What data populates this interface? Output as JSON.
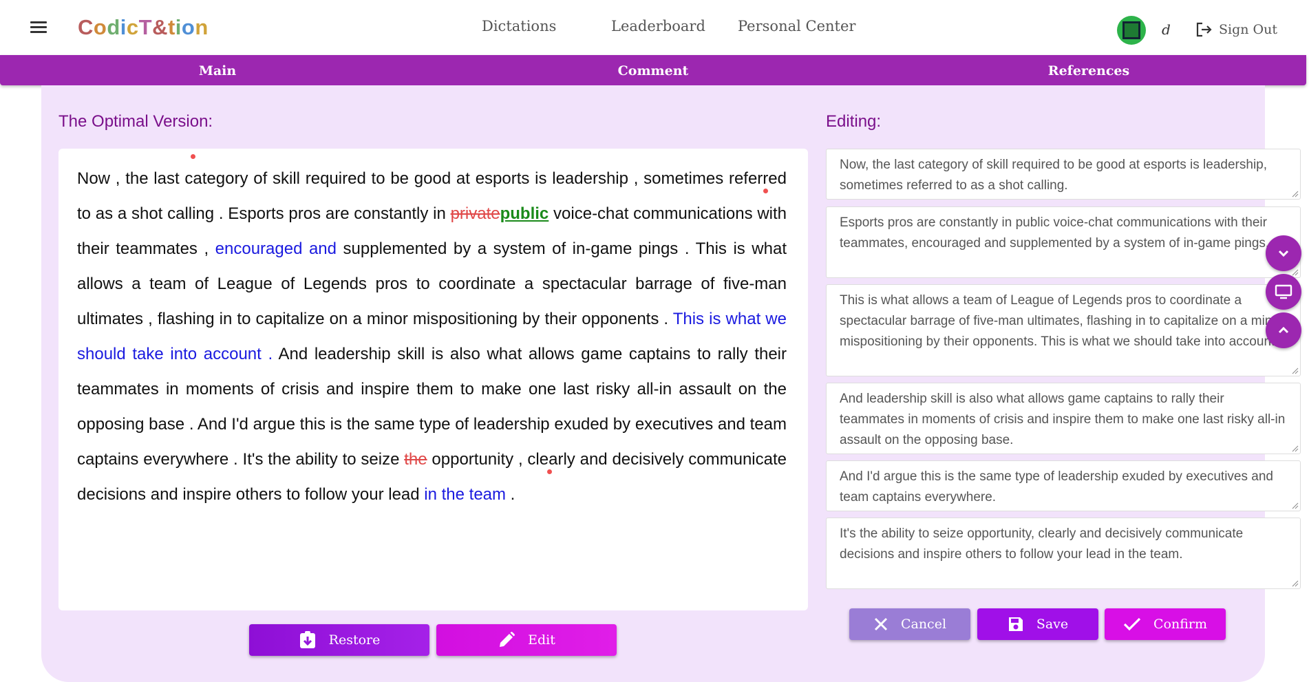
{
  "header": {
    "logo": "CodicT&tion",
    "nav": [
      "Dictations",
      "Leaderboard",
      "Personal Center"
    ],
    "username": "d",
    "signout_label": "Sign Out"
  },
  "tabs": [
    "Main",
    "Comment",
    "References"
  ],
  "optimal": {
    "label": "The Optimal Version:",
    "segments": [
      {
        "t": "Now , the last category of skill required to be good at esports is leadership , sometimes referred to as a shot calling . Esports pros are constantly in "
      },
      {
        "t": "private",
        "s": "del"
      },
      {
        "t": "public",
        "s": "rep"
      },
      {
        "t": " voice-chat communications with their teammates , "
      },
      {
        "t": "encouraged and",
        "s": "ins"
      },
      {
        "t": " supplemented by a system of in-game pings . This is what allows a team of League of Legends pros to coordinate a spectacular barrage of five-man ultimates , flashing in to capitalize on a minor mispositioning by their opponents . "
      },
      {
        "t": "This is what we should take into account .",
        "s": "ins"
      },
      {
        "t": " And leadership skill is also what allows game captains to rally their teammates in moments of crisis and inspire them to make one last risky all-in assault on the opposing base . And I'd argue this is the same type of leadership exuded by executives and team captains everywhere . It's the ability to seize "
      },
      {
        "t": "the",
        "s": "del"
      },
      {
        "t": " opportunity , clearly and decisively communicate decisions and inspire others to follow your lead "
      },
      {
        "t": "in the team",
        "s": "ins"
      },
      {
        "t": " ."
      }
    ],
    "restore_label": "Restore",
    "edit_label": "Edit"
  },
  "editing": {
    "label": "Editing:",
    "boxes": [
      "Now, the last category of skill required to be good at esports is leadership, sometimes referred to as a shot calling.",
      "Esports pros are constantly in public voice-chat communications with their teammates, encouraged and supplemented by a system of in-game pings.",
      "This is what allows a team of League of Legends pros to coordinate a spectacular barrage of five-man ultimates, flashing in to capitalize on a minor mispositioning by their opponents. This is what we should take into account.",
      "And leadership skill is also what allows game captains to rally their teammates in moments of crisis and inspire them to make one last risky all-in assault on the opposing base.",
      "And I'd argue this is the same type of leadership exuded by executives and team captains everywhere.",
      "It's the ability to seize  opportunity, clearly and decisively communicate decisions and inspire others to follow your lead in the team."
    ],
    "cancel_label": "Cancel",
    "save_label": "Save",
    "confirm_label": "Confirm"
  },
  "colors": {
    "primary": "#9c27b0",
    "panel_bg": "#f2e3fb",
    "inserted": "#1a1adf",
    "deleted": "#e04848",
    "replaced": "#1a8a1a"
  }
}
